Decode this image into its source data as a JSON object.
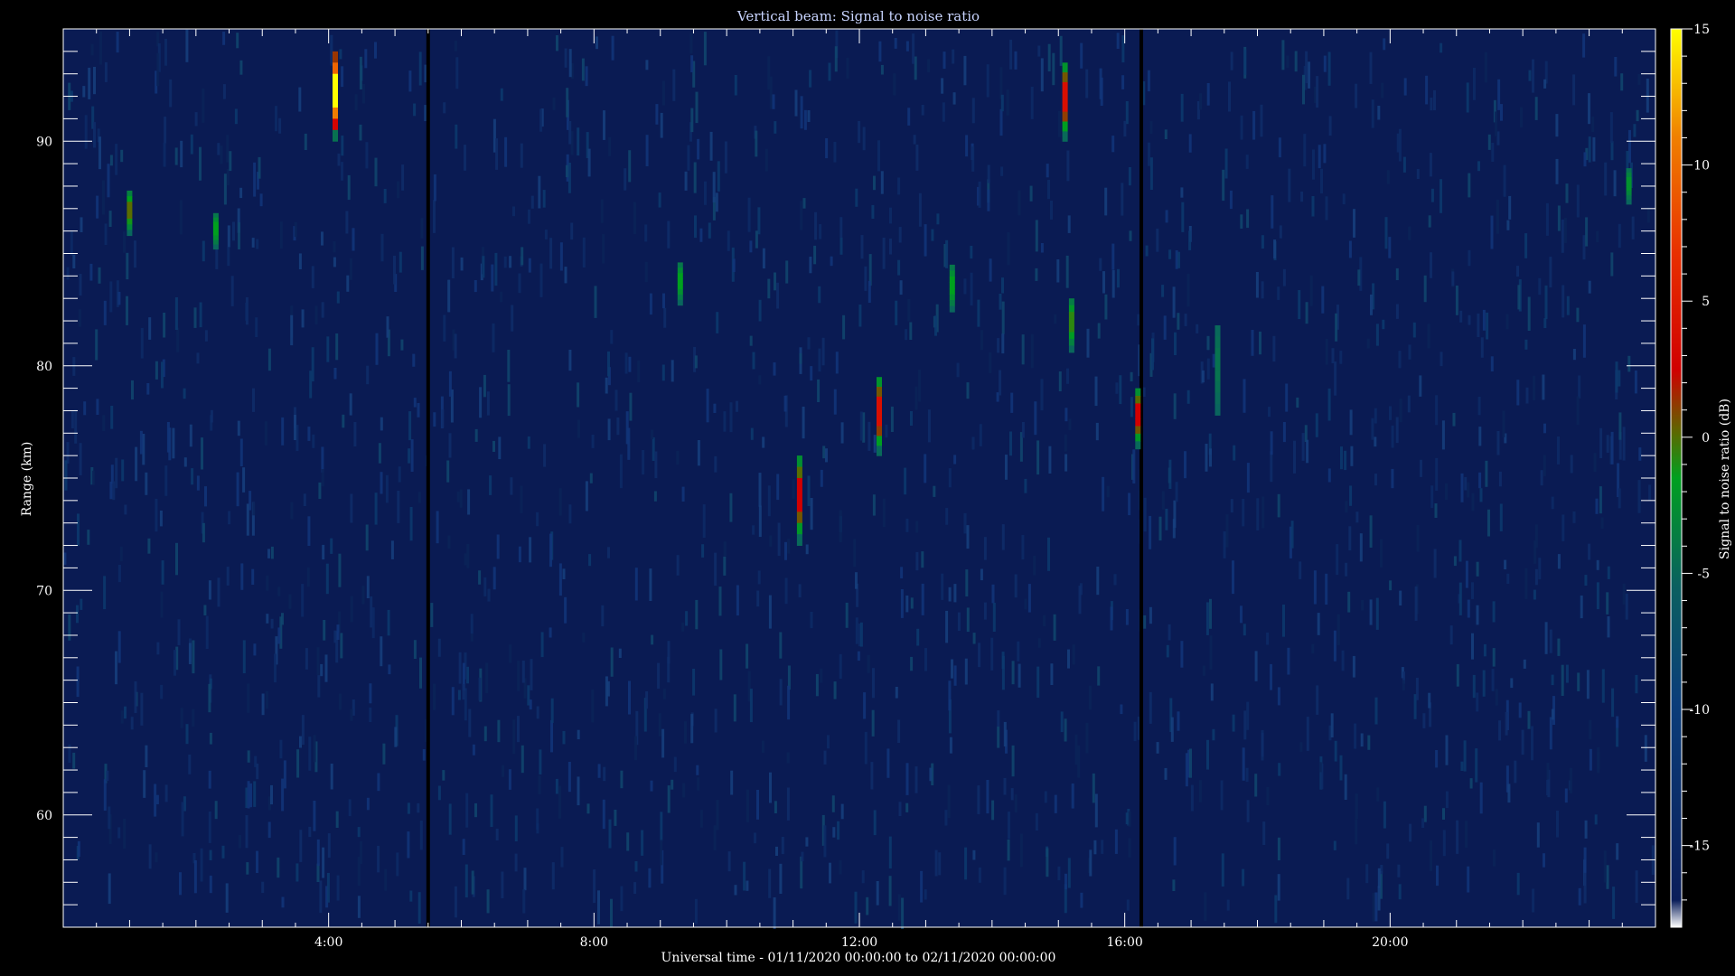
{
  "chart_data": {
    "type": "heatmap",
    "title": "Vertical beam: Signal to noise ratio",
    "xlabel": "Universal time - 01/11/2020 00:00:00 to 02/11/2020 00:00:00",
    "ylabel": "Range (km)",
    "colorbar_label": "Signal to noise ratio (dB)",
    "xlim_hours": [
      0,
      24
    ],
    "x_ticks": [
      {
        "value": 4,
        "label": "4:00"
      },
      {
        "value": 8,
        "label": "8:00"
      },
      {
        "value": 12,
        "label": "12:00"
      },
      {
        "value": 16,
        "label": "16:00"
      },
      {
        "value": 20,
        "label": "20:00"
      }
    ],
    "ylim_km": [
      55,
      95
    ],
    "y_ticks": [
      {
        "value": 60,
        "label": "60"
      },
      {
        "value": 70,
        "label": "70"
      },
      {
        "value": 80,
        "label": "80"
      },
      {
        "value": 90,
        "label": "90"
      }
    ],
    "clim_db": [
      -18,
      15
    ],
    "c_ticks": [
      {
        "value": 15,
        "label": "15"
      },
      {
        "value": 10,
        "label": "10"
      },
      {
        "value": 5,
        "label": "5"
      },
      {
        "value": 0,
        "label": "0"
      },
      {
        "value": -5,
        "label": "-5"
      },
      {
        "value": -10,
        "label": "-10"
      },
      {
        "value": -15,
        "label": "-15"
      }
    ],
    "background_db": -16,
    "data_gaps_hours": [
      5.5,
      16.25
    ],
    "echoes": [
      {
        "time_h": 1.0,
        "range_km": [
          85.8,
          87.8
        ],
        "peak_db": -3
      },
      {
        "time_h": 2.3,
        "range_km": [
          85.2,
          86.8
        ],
        "peak_db": -5
      },
      {
        "time_h": 4.1,
        "range_km": [
          90.0,
          94.0
        ],
        "peak_db": 15
      },
      {
        "time_h": 9.3,
        "range_km": [
          82.7,
          84.6
        ],
        "peak_db": -5
      },
      {
        "time_h": 11.1,
        "range_km": [
          72.0,
          76.0
        ],
        "peak_db": 0
      },
      {
        "time_h": 12.3,
        "range_km": [
          76.0,
          79.5
        ],
        "peak_db": 1
      },
      {
        "time_h": 13.4,
        "range_km": [
          82.4,
          84.5
        ],
        "peak_db": -5
      },
      {
        "time_h": 15.1,
        "range_km": [
          90.0,
          93.5
        ],
        "peak_db": 1
      },
      {
        "time_h": 15.2,
        "range_km": [
          80.6,
          83.0
        ],
        "peak_db": -4
      },
      {
        "time_h": 16.2,
        "range_km": [
          76.3,
          79.0
        ],
        "peak_db": 0
      },
      {
        "time_h": 17.4,
        "range_km": [
          77.8,
          81.8
        ],
        "peak_db": -8
      },
      {
        "time_h": 23.6,
        "range_km": [
          87.2,
          88.8
        ],
        "peak_db": -6
      }
    ]
  }
}
